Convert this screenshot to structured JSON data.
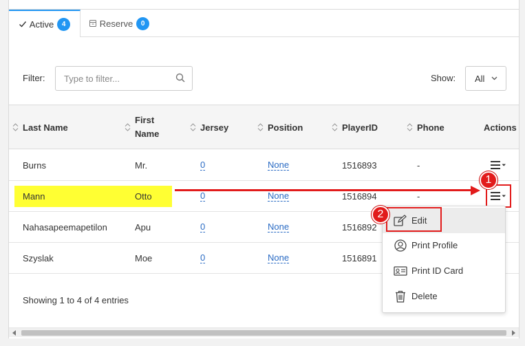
{
  "tabs": [
    {
      "label": "Active",
      "count": "4",
      "icon": "check-icon"
    },
    {
      "label": "Reserve",
      "count": "0",
      "icon": "archive-icon"
    }
  ],
  "filter": {
    "label": "Filter:",
    "placeholder": "Type to filter..."
  },
  "show": {
    "label": "Show:",
    "value": "All"
  },
  "table": {
    "columns": [
      "Last Name",
      "First\nName",
      "Jersey",
      "Position",
      "PlayerID",
      "Phone",
      "Actions"
    ],
    "rows": [
      {
        "last": "Burns",
        "first": "Mr.",
        "jersey": "0",
        "position": "None",
        "player_id": "1516893",
        "phone": "-"
      },
      {
        "last": "Mann",
        "first": "Otto",
        "jersey": "0",
        "position": "None",
        "player_id": "1516894",
        "phone": "-"
      },
      {
        "last": "Nahasapeemapetilon",
        "first": "Apu",
        "jersey": "0",
        "position": "None",
        "player_id": "1516892",
        "phone": ""
      },
      {
        "last": "Szyslak",
        "first": "Moe",
        "jersey": "0",
        "position": "None",
        "player_id": "1516891",
        "phone": ""
      }
    ]
  },
  "footer": {
    "info": "Showing 1 to 4 of 4 entries"
  },
  "actions_menu": {
    "items": [
      {
        "label": "Edit",
        "icon": "edit-icon"
      },
      {
        "label": "Print Profile",
        "icon": "user-circle-icon"
      },
      {
        "label": "Print ID Card",
        "icon": "id-card-icon"
      },
      {
        "label": "Delete",
        "icon": "trash-icon"
      }
    ]
  },
  "annotations": {
    "step1": "1",
    "step2": "2"
  },
  "colors": {
    "accent": "#2196f3",
    "annotation": "#e21b1b",
    "highlight": "#ffff33",
    "link": "#2a6bc4"
  }
}
